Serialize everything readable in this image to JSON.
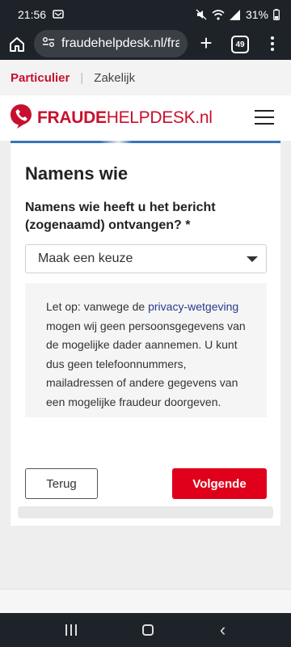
{
  "status": {
    "time": "21:56",
    "battery": "31%"
  },
  "browser": {
    "url": "fraudehelpdesk.nl/frau",
    "tab_count": "49"
  },
  "subnav": {
    "active": "Particulier",
    "separator": "|",
    "other": "Zakelijk"
  },
  "brand": {
    "name_bold": "FRAUDE",
    "name_regular": "HELPDESK",
    "tld": ".nl",
    "color": "#c8102e"
  },
  "form": {
    "heading": "Namens wie",
    "question": "Namens wie heeft u het bericht (zogenaamd) ontvangen? *",
    "select_value": "Maak een keuze",
    "notice_before_link": "Let op: vanwege de ",
    "notice_link": "privacy-wetgeving",
    "notice_after_link": " mogen wij geen persoonsgegevens van de mogelijke dader aannemen. U kunt dus geen telefoonnummers, mailadressen of andere gegevens van een mogelijke fraudeur doorgeven.",
    "back_label": "Terug",
    "next_label": "Volgende",
    "next_color": "#e0001b"
  }
}
